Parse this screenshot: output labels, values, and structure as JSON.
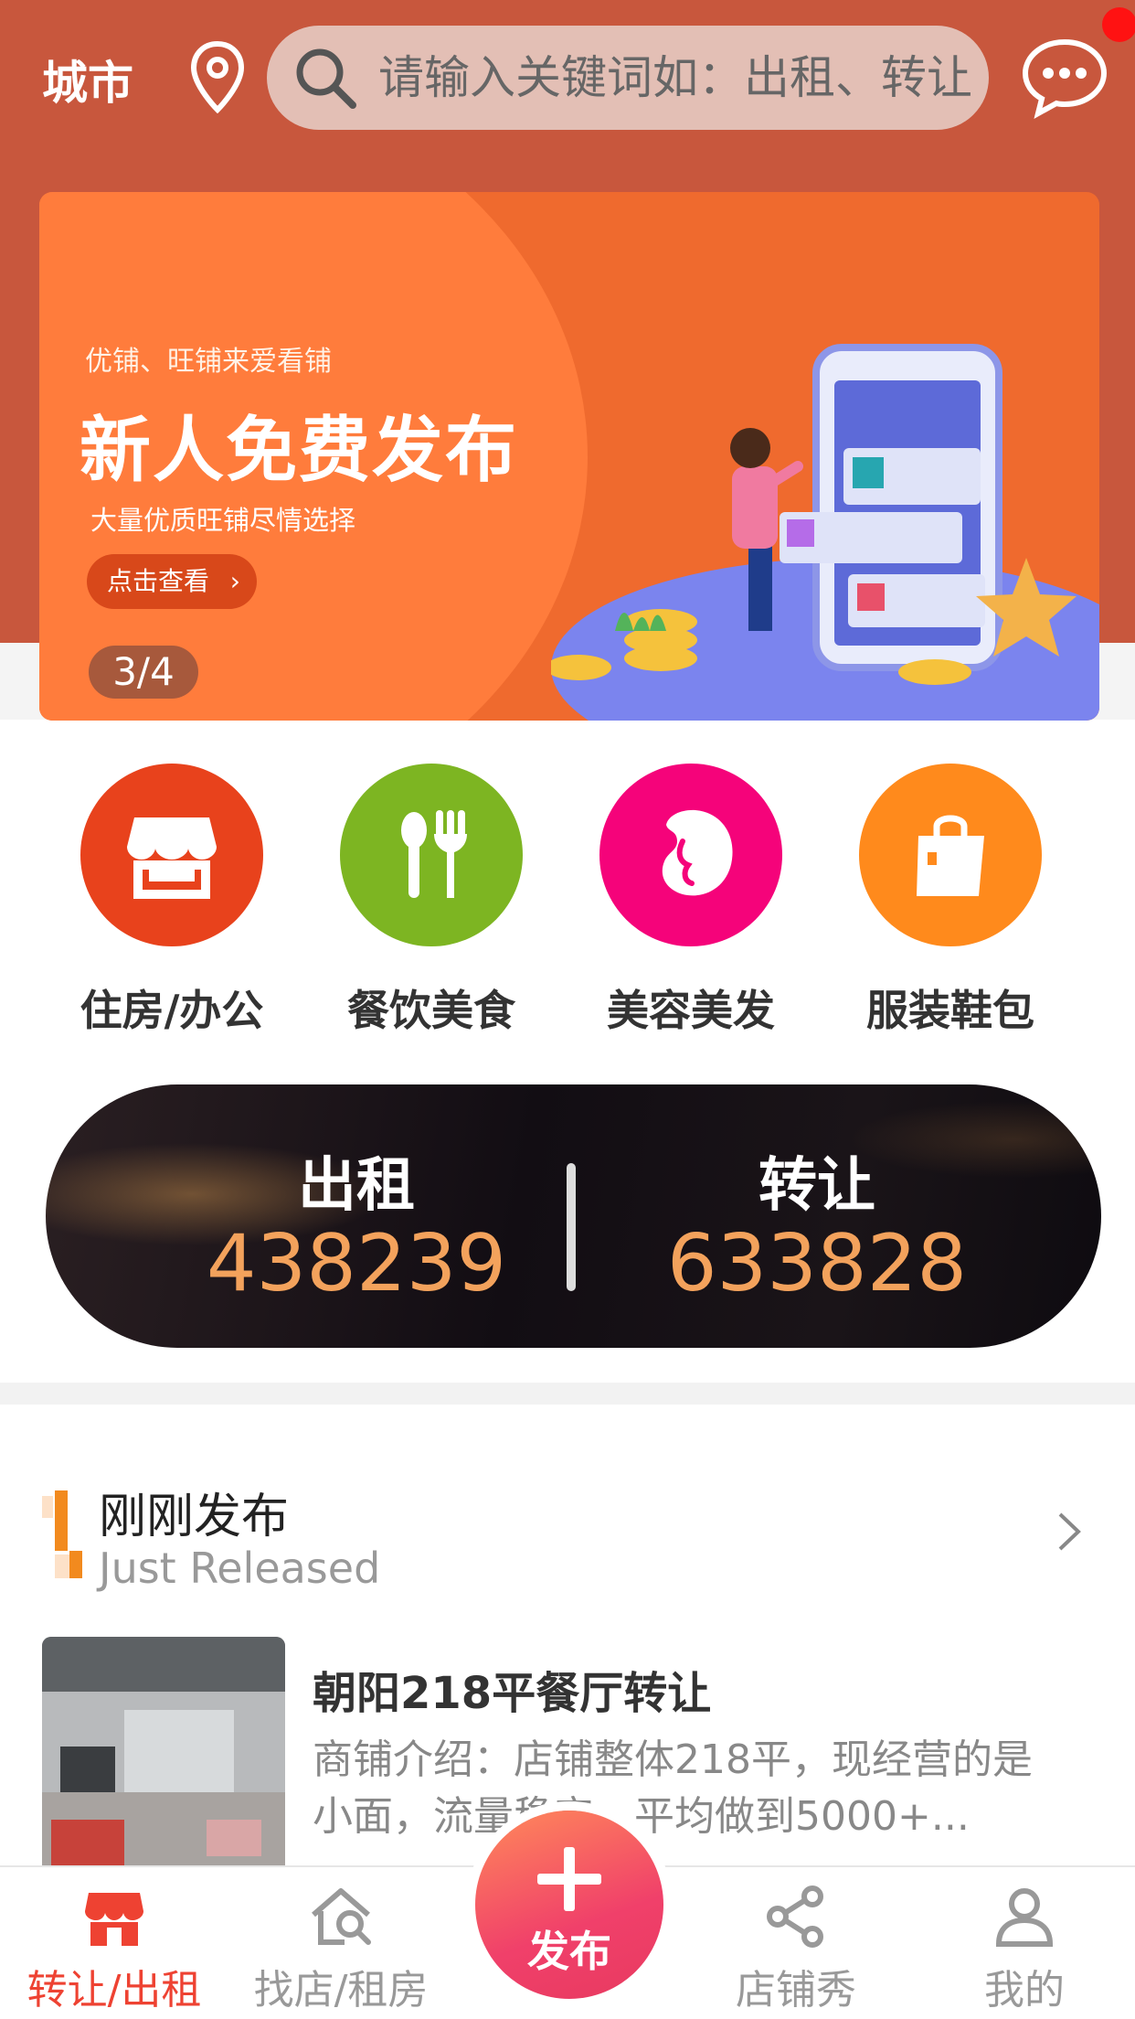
{
  "header": {
    "city": "城市",
    "search_placeholder": "请输入关键词如：出租、转让"
  },
  "banner": {
    "tagline": "优铺、旺铺来爱看铺",
    "title": "新人免费发布",
    "subtitle": "大量优质旺铺尽情选择",
    "button": "点击查看",
    "page_indicator": "3/4"
  },
  "categories": [
    {
      "label": "住房/办公",
      "icon": "storefront-icon",
      "color": "#e8421c"
    },
    {
      "label": "餐饮美食",
      "icon": "utensils-icon",
      "color": "#7db522"
    },
    {
      "label": "美容美发",
      "icon": "beauty-face-icon",
      "color": "#f5037a"
    },
    {
      "label": "服装鞋包",
      "icon": "shopping-bag-icon",
      "color": "#ff8a1c"
    }
  ],
  "stats": {
    "rent_label": "出租",
    "rent_value": "438239",
    "transfer_label": "转让",
    "transfer_value": "633828"
  },
  "section": {
    "title": "刚刚发布",
    "subtitle": "Just Released"
  },
  "listing": {
    "title": "朝阳218平餐厅转让",
    "description": "商铺介绍：店铺整体218平，现经营的是小面，流量稳定，平均做到5000+..."
  },
  "nav": {
    "items": [
      {
        "label": "转让/出租",
        "active": true
      },
      {
        "label": "找店/租房",
        "active": false
      },
      {
        "label": "店铺秀",
        "active": false
      },
      {
        "label": "我的",
        "active": false
      }
    ],
    "publish": "发布"
  },
  "colors": {
    "header": "#c8573d",
    "accent": "#ee4232",
    "stat_value": "#f3a25c"
  }
}
